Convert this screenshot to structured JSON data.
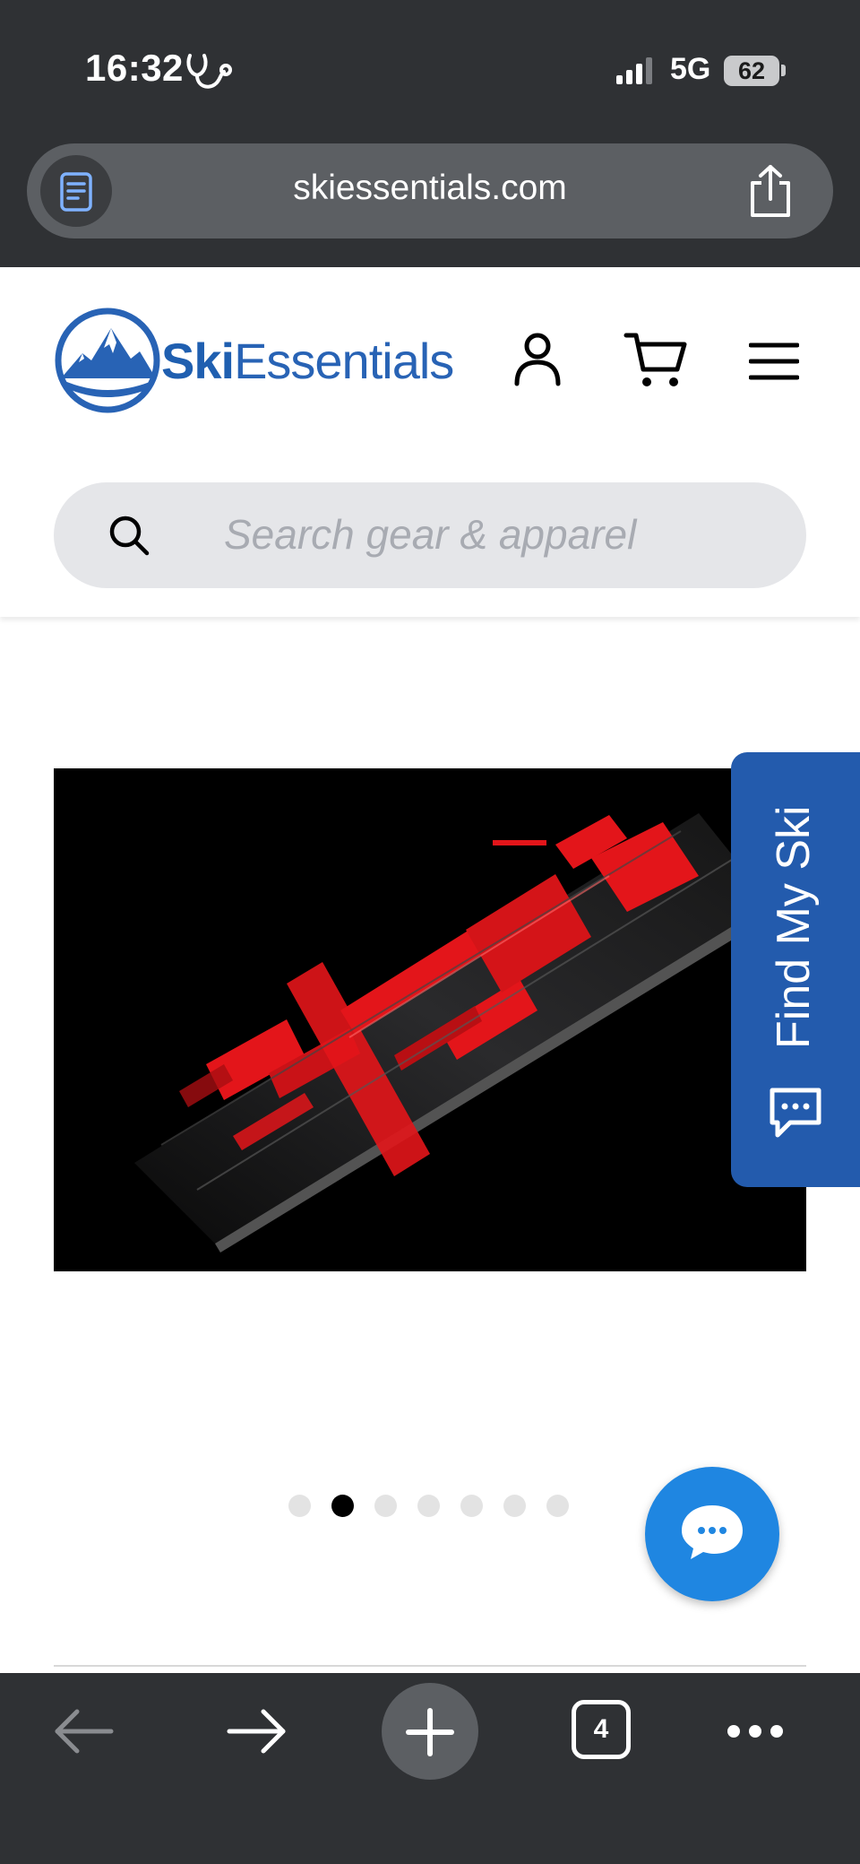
{
  "status_bar": {
    "time": "16:32",
    "network": "5G",
    "battery": "62"
  },
  "browser": {
    "url": "skiessentials.com",
    "open_tabs_count": "4"
  },
  "header": {
    "logo_ski": "Ski",
    "logo_essentials": "Essentials",
    "search_placeholder": "Search gear & apparel"
  },
  "hero": {
    "active_slide_index": 1,
    "slide_count": 7
  },
  "side_tab": {
    "label": "Find My Ski"
  },
  "icons": {
    "status": [
      "stethoscope-icon",
      "signal-icon"
    ],
    "browser": [
      "reader-icon",
      "share-icon",
      "back-icon",
      "forward-icon",
      "plus-icon",
      "more-icon"
    ],
    "site": [
      "account-icon",
      "cart-icon",
      "menu-icon",
      "search-icon",
      "chat-bubble-icon",
      "chat-fab-icon"
    ]
  },
  "colors": {
    "chrome_bg": "#2f3134",
    "address_bar": "#5c5f63",
    "brand_blue": "#2863b5",
    "find_ski_tab": "#235bad",
    "chat_fab": "#1f86e1",
    "search_bg": "#e5e6e9",
    "hero_accent_red": "#e3151a"
  }
}
